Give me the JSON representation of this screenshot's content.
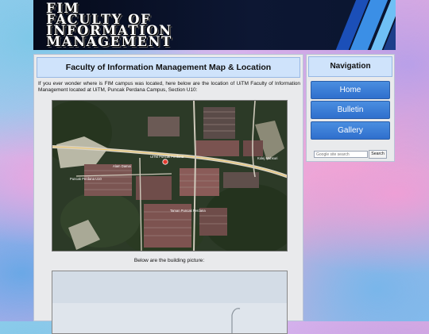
{
  "header": {
    "logo_lines": [
      "FIM",
      "FACULTY OF",
      "INFORMATION",
      "MANAGEMENT"
    ]
  },
  "main": {
    "title": "Faculty of Information Management Map & Location",
    "intro": "If you ever wonder where is FIM campus was located, here below are the location of UiTM Faculty of Information Management located at UiTM, Puncak Perdana Campus, Section U10:",
    "map_labels": {
      "road_a": "UiTM Puncak Perdana",
      "place_b": "Kolej Mahsuri",
      "place_c": "Alam Damai",
      "place_d": "Taman Puncak Perdana",
      "place_e": "Puncak Perdana U10"
    },
    "caption": "Below are the building picture:"
  },
  "sidebar": {
    "title": "Navigation",
    "nav_items": [
      "Home",
      "Bulletin",
      "Gallery"
    ],
    "search": {
      "placeholder": "Google site search",
      "button_label": "Search"
    }
  },
  "colors": {
    "nav_button": "#3a7ed8",
    "panel_title_bg": "#cfe3fb",
    "header_bg": "#0b1430",
    "accent_stripe": "#3b8fe6"
  }
}
